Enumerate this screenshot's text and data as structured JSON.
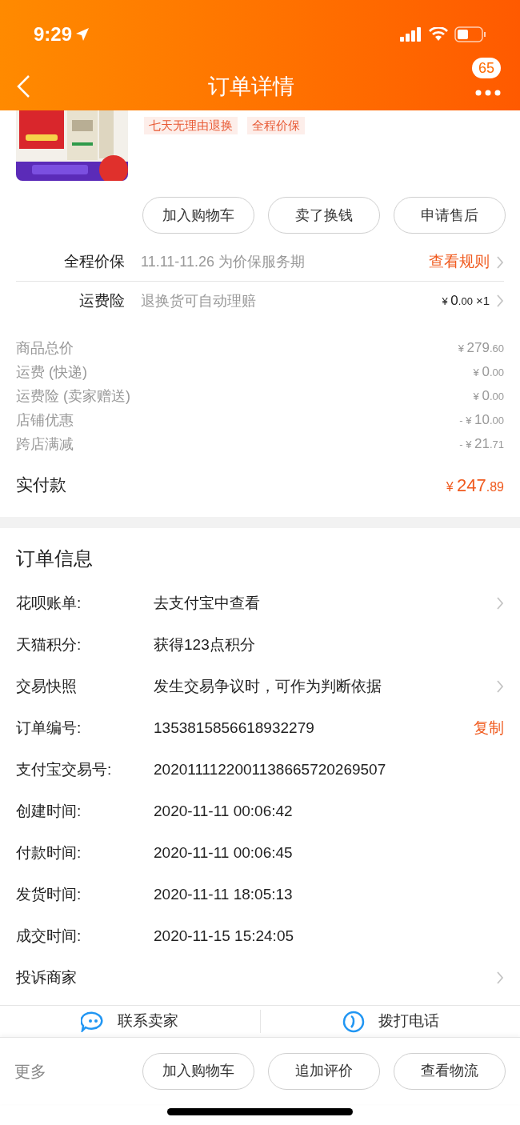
{
  "status_bar": {
    "time": "9:29"
  },
  "nav": {
    "title": "订单详情",
    "badge": "65"
  },
  "product": {
    "image": {
      "kind": "picture"
    },
    "tags": [
      "七天无理由退换",
      "全程价保"
    ],
    "buttons": [
      "加入购物车",
      "卖了换钱",
      "申请售后"
    ]
  },
  "services": [
    {
      "kind": "link",
      "label": "全程价保",
      "text": "11.11-11.26 为价保服务期",
      "action": "查看规则"
    },
    {
      "kind": "price",
      "label": "运费险",
      "text": "退换货可自动理赔",
      "prefix": "¥",
      "integer": "0",
      "decimal": ".00",
      "count": "×1"
    }
  ],
  "price_lines": [
    {
      "label": "商品总价",
      "prefix": "¥",
      "integer": "279",
      "decimal": ".60"
    },
    {
      "label": "运费 (快递)",
      "prefix": "¥",
      "integer": "0",
      "decimal": ".00"
    },
    {
      "label": "运费险 (卖家赠送)",
      "prefix": "¥",
      "integer": "0",
      "decimal": ".00"
    },
    {
      "label": "店铺优惠",
      "prefix": "- ¥",
      "integer": "10",
      "decimal": ".00"
    },
    {
      "label": "跨店满减",
      "prefix": "- ¥",
      "integer": "21",
      "decimal": ".71"
    }
  ],
  "total": {
    "label": "实付款",
    "prefix": "¥",
    "integer": "247",
    "decimal": ".89"
  },
  "order_info": {
    "title": "订单信息",
    "rows": [
      {
        "kind": "link",
        "label": "花呗账单:",
        "value": "去支付宝中查看"
      },
      {
        "kind": "plain",
        "label": "天猫积分:",
        "value": "获得123点积分"
      },
      {
        "kind": "link",
        "label": "交易快照",
        "value": "发生交易争议时，可作为判断依据"
      },
      {
        "kind": "action",
        "label": "订单编号:",
        "value": "1353815856618932279",
        "action": "复制"
      },
      {
        "kind": "plain",
        "label": "支付宝交易号:",
        "value": "2020111122001138665720269507"
      },
      {
        "kind": "plain",
        "label": "创建时间:",
        "value": "2020-11-11 00:06:42"
      },
      {
        "kind": "plain",
        "label": "付款时间:",
        "value": "2020-11-11 00:06:45"
      },
      {
        "kind": "plain",
        "label": "发货时间:",
        "value": "2020-11-11 18:05:13"
      },
      {
        "kind": "plain",
        "label": "成交时间:",
        "value": "2020-11-15 15:24:05"
      },
      {
        "kind": "link",
        "label": "投诉商家",
        "value": ""
      }
    ]
  },
  "contact": [
    {
      "kind": "chat",
      "label": "联系卖家"
    },
    {
      "kind": "phone",
      "label": "拨打电话"
    }
  ],
  "bottom_bar": {
    "more": "更多",
    "buttons": [
      "加入购物车",
      "追加评价",
      "查看物流"
    ]
  }
}
